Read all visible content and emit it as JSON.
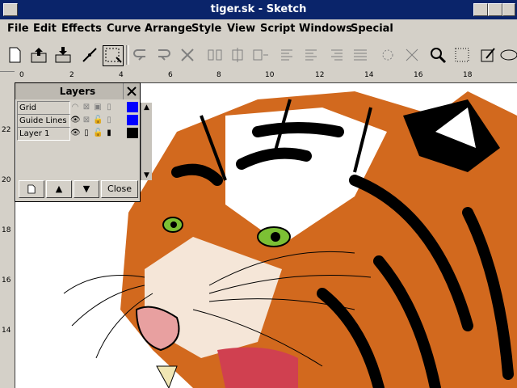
{
  "window": {
    "title": "tiger.sk - Sketch"
  },
  "menu": [
    "File",
    "Edit",
    "Effects",
    "Curve",
    "Arrange",
    "Style",
    "View",
    "Script",
    "Windows",
    "Special"
  ],
  "ruler": {
    "h_labels": [
      "0",
      "2",
      "4",
      "6",
      "8",
      "10",
      "12",
      "14",
      "16",
      "18"
    ],
    "v_labels": [
      "22",
      "20",
      "18",
      "16",
      "14"
    ]
  },
  "layers_panel": {
    "title": "Layers",
    "rows": [
      {
        "name": "Grid",
        "color": "#0000ff"
      },
      {
        "name": "Guide Lines",
        "color": "#0000ff"
      },
      {
        "name": "Layer 1",
        "color": "#000000"
      }
    ],
    "close_label": "Close"
  },
  "icons": [
    "new-icon",
    "open-icon",
    "save-icon",
    "edit-icon",
    "select-icon",
    "undo-icon",
    "redo-icon",
    "delete-icon",
    "align-icons",
    "zoom-icon",
    "grid-icon",
    "pen-icon",
    "ellipse-icon"
  ]
}
